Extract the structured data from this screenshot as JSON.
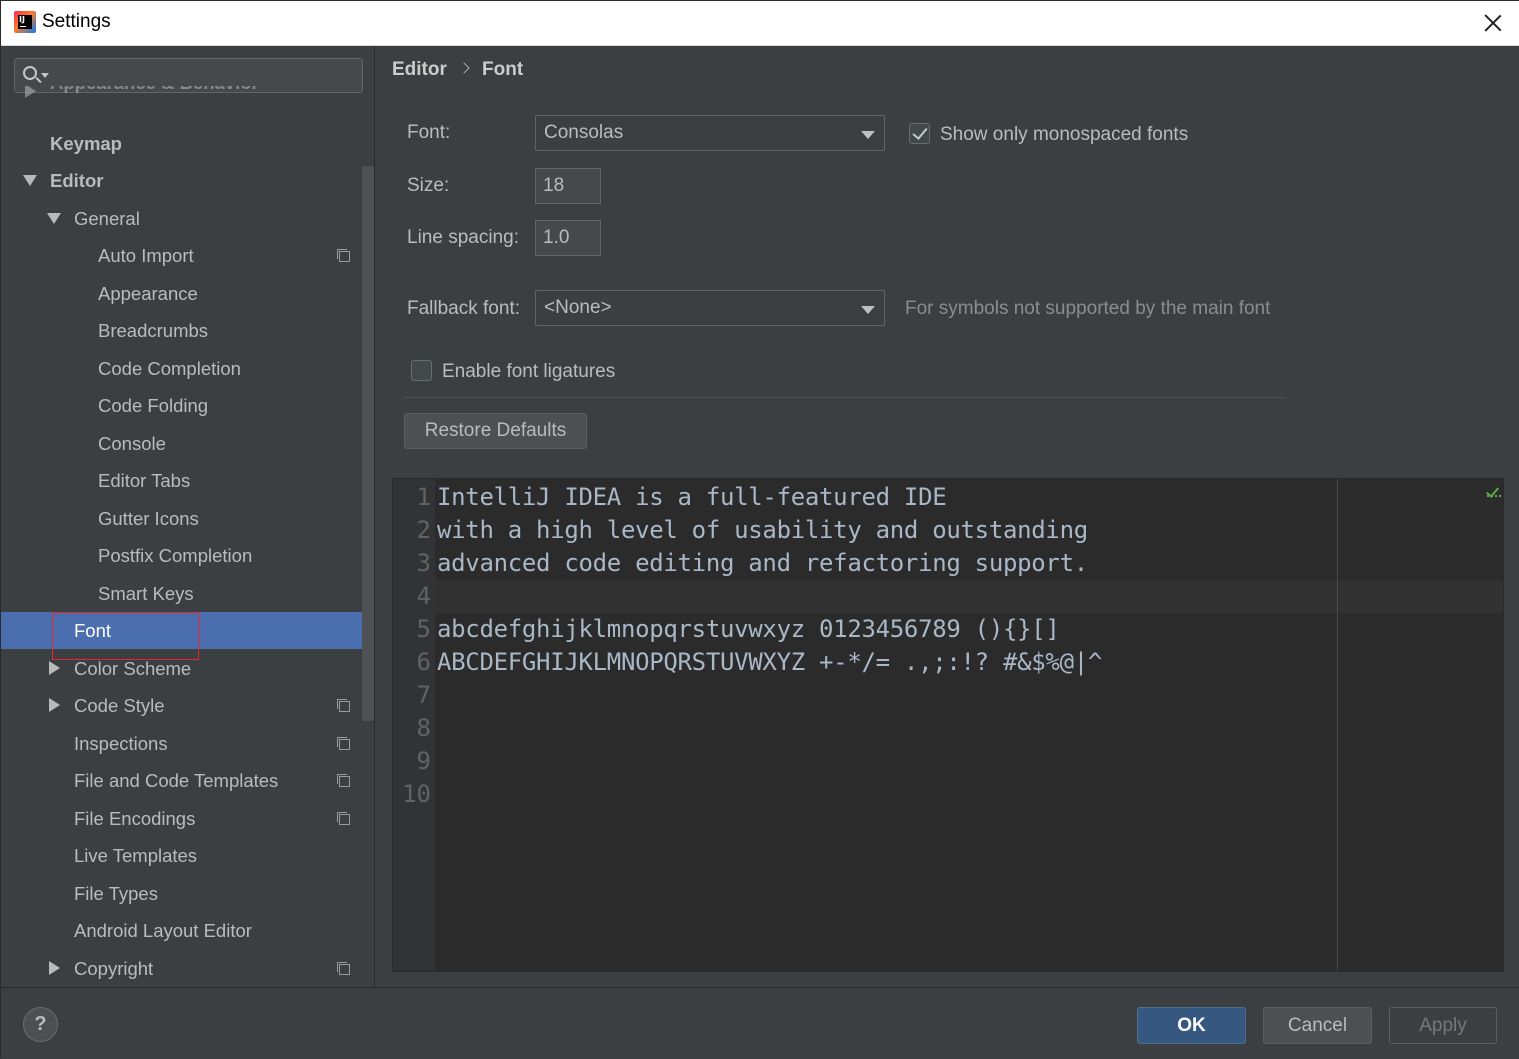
{
  "window": {
    "title": "Settings"
  },
  "sidebar": {
    "search_placeholder": "",
    "items": [
      {
        "label": "Appearance & Behavior"
      },
      {
        "label": "Keymap"
      },
      {
        "label": "Editor"
      },
      {
        "label": "General"
      },
      {
        "label": "Auto Import"
      },
      {
        "label": "Appearance"
      },
      {
        "label": "Breadcrumbs"
      },
      {
        "label": "Code Completion"
      },
      {
        "label": "Code Folding"
      },
      {
        "label": "Console"
      },
      {
        "label": "Editor Tabs"
      },
      {
        "label": "Gutter Icons"
      },
      {
        "label": "Postfix Completion"
      },
      {
        "label": "Smart Keys"
      },
      {
        "label": "Font"
      },
      {
        "label": "Color Scheme"
      },
      {
        "label": "Code Style"
      },
      {
        "label": "Inspections"
      },
      {
        "label": "File and Code Templates"
      },
      {
        "label": "File Encodings"
      },
      {
        "label": "Live Templates"
      },
      {
        "label": "File Types"
      },
      {
        "label": "Android Layout Editor"
      },
      {
        "label": "Copyright"
      }
    ],
    "selected": "Font"
  },
  "breadcrumb": {
    "parent": "Editor",
    "current": "Font"
  },
  "font_settings": {
    "font_label": "Font:",
    "font_value": "Consolas",
    "mono_only_label": "Show only monospaced fonts",
    "mono_only_checked": true,
    "size_label": "Size:",
    "size_value": "18",
    "line_spacing_label": "Line spacing:",
    "line_spacing_value": "1.0",
    "fallback_label": "Fallback font:",
    "fallback_value": "<None>",
    "fallback_hint": "For symbols not supported by the main font",
    "ligatures_label": "Enable font ligatures",
    "ligatures_checked": false,
    "restore_label": "Restore Defaults"
  },
  "preview": {
    "line_numbers": [
      "1",
      "2",
      "3",
      "4",
      "5",
      "6",
      "7",
      "8",
      "9",
      "10"
    ],
    "lines": [
      "IntelliJ IDEA is a full-featured IDE",
      "with a high level of usability and outstanding",
      "advanced code editing and refactoring support.",
      "",
      "abcdefghijklmnopqrstuvwxyz 0123456789 (){}[]",
      "ABCDEFGHIJKLMNOPQRSTUVWXYZ +-*/= .,;:!? #&$%@|^"
    ]
  },
  "dialog": {
    "help": "?",
    "ok": "OK",
    "cancel": "Cancel",
    "apply": "Apply"
  },
  "colors": {
    "selection": "#4b6eaf",
    "ok_button": "#365880",
    "highlight_box": "#e8242d"
  }
}
